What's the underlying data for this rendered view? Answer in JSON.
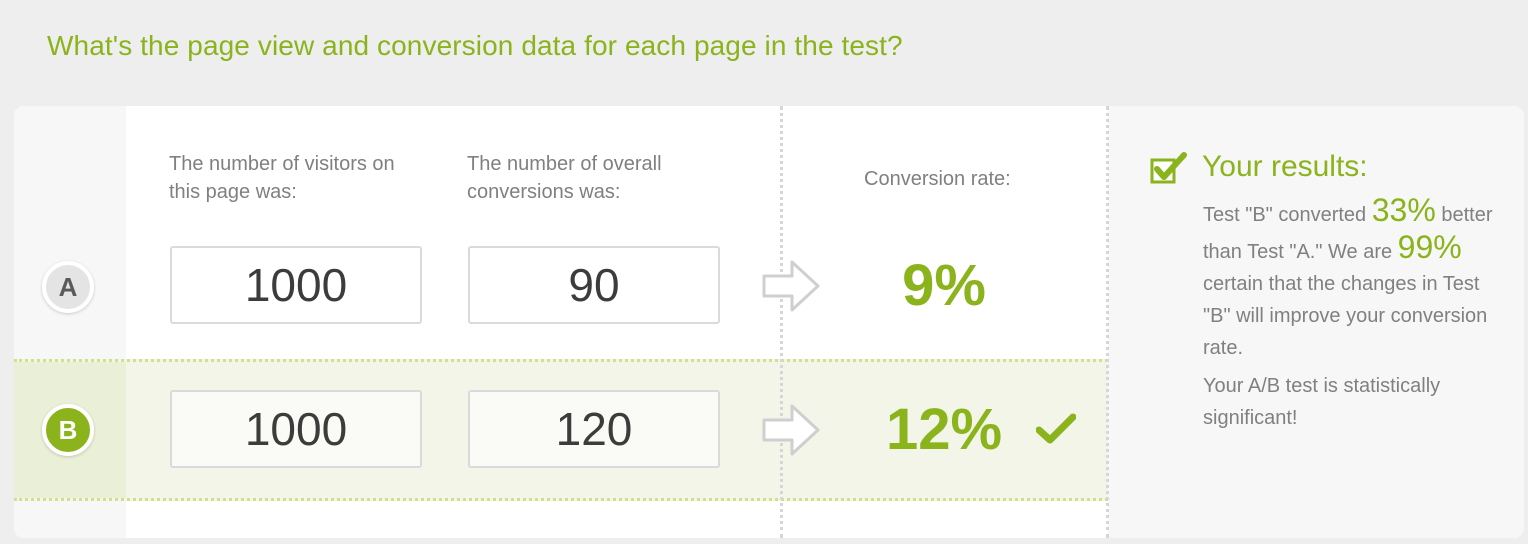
{
  "question": "What's the page view and conversion data for each page in the test?",
  "columns": {
    "visitors_line1": "The number of visitors on",
    "visitors_line2": "this page was:",
    "conversions_line1": "The number of overall",
    "conversions_line2": "conversions was:",
    "rate": "Conversion rate:"
  },
  "rows": [
    {
      "label": "A",
      "visitors": "1000",
      "conversions": "90",
      "rate": "9%",
      "winner": false
    },
    {
      "label": "B",
      "visitors": "1000",
      "conversions": "120",
      "rate": "12%",
      "winner": true
    }
  ],
  "results": {
    "title": "Your results:",
    "t1": "Test \"B\" converted ",
    "improvement": "33%",
    "t2": " better than Test \"A.\" We are ",
    "confidence": "99%",
    "t3": " certain that the changes in Test \"B\" will improve your conversion rate.",
    "significance": "Your A/B test is statistically significant!"
  },
  "colors": {
    "accent": "#8ab31c",
    "text_gray": "#808080",
    "background": "#eeeeee"
  },
  "icons": {
    "arrow": "right-arrow-icon",
    "winner": "checkmark-icon",
    "results": "checkbox-checked-icon"
  }
}
